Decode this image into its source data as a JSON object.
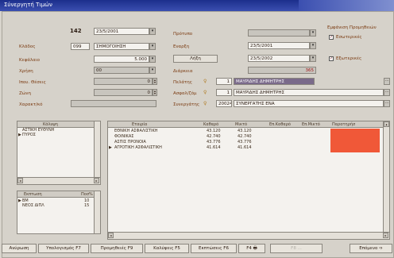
{
  "window": {
    "title": "Σύνεργητή Τιμών"
  },
  "form": {
    "number": "142",
    "date1": "23/5/2001",
    "klados_label": "Κλάδος",
    "klados_code": "099",
    "klados_value": "ΣΗΜΟΓΟΙΗΣΗ",
    "kefalaio_label": "Κεφάλαιο",
    "kefalaio_value": "5.000",
    "xrisi_label": "Χρήση",
    "xrisi_value": "00",
    "ekt_label": "Ιπου. Θέσεις",
    "ekt_value": "0",
    "zoni_label": "Ζώνη",
    "zoni_value": "0",
    "xarakt_label": "Χαρακτ/κό",
    "protypo_label": "Πρότυπο",
    "enarxi_label": "Εναρξη",
    "enarxi_value": "23/5/2001",
    "lixi_label": "Λήξη",
    "lixi_value": "23/5/2002",
    "diarkeia_label": "Διάρκεια",
    "diarkeia_value": "365",
    "pelatis_label": "Πελάτης",
    "pelatis_code": "1",
    "pelatis_name": "ΜΑΥΡΙΔΗΣ ΔΗΜΗΤΡΗΣ",
    "asfalis_label": "Ασφαλ/ζόμ",
    "asfalis_code": "1",
    "asfalis_name": "ΜΑΥΡΙΔΗΣ ΔΗΜΗΤΡΗΣ",
    "synergatis_label": "Συνεργάτης",
    "synergatis_code": "20024",
    "synergatis_name": "ΣΥΝΕΡΓΑΤΗΣ ΕΝΑ",
    "emfanisi_label": "Εμφάνιση Προμηθειών",
    "esoterikes_label": "Εσωτερικές",
    "eksoterikes_label": "Εξωτερικές",
    "dots": "..."
  },
  "kalypsi_grid": {
    "header": "Κάλυψη",
    "rows": [
      "ΑΣΤΙΚΗ ΕΥΘΥΝΗ",
      "ΠΥΡΟΣ"
    ]
  },
  "ekptosi_grid": {
    "headers": [
      "Εκπτωση",
      "Ποσ%"
    ],
    "rows": [
      [
        "ΒΜ",
        "10"
      ],
      [
        "ΝΕΟΣ ΔΙΠΛ",
        "15"
      ]
    ]
  },
  "etaireia_grid": {
    "headers": [
      "Εταιρία",
      "Καθαρό",
      "Μικτό",
      "Επ.Καθαρό",
      "Επ.Μικτό",
      "Παρατηρήσ"
    ],
    "rows": [
      [
        "ΕΘΝΙΚΗ ΑΣΦΑΛΙΣΤΙΚΗ",
        "43.120",
        "43.120"
      ],
      [
        "ΦΟΙΝΙΚΑΣ",
        "42.740",
        "42.740"
      ],
      [
        "ΑΣΠΙΣ ΠΡΟΝΟΙΑ",
        "43.776",
        "43.776"
      ],
      [
        "ΑΓΡΟΤΙΚΗ ΑΣΦΑΛΙΣΤΙΚΗ",
        "41.614",
        "41.614"
      ]
    ],
    "red_cell_color": "#f05838"
  },
  "footer": {
    "anoirosi": "Ανύρωση",
    "ypologismos": "Υπολογισμός F7",
    "promitheies": "Προμηθειές F9",
    "kalypseis": "Καλύψεις F5",
    "ekptoseis": "Εκπτώσεις F6",
    "f4": "F4",
    "disabled": "F8 ...",
    "epomeno": "Επόμενο"
  },
  "icons": {
    "arrow": "arrow-right-icon",
    "bulb": "bulb-icon",
    "printer": "printer-icon"
  }
}
